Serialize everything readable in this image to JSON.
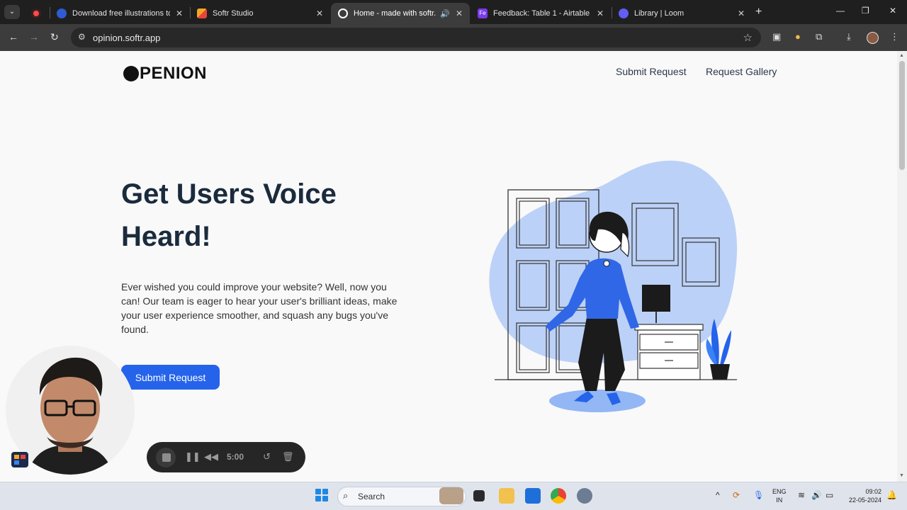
{
  "browser": {
    "tabs": [
      {
        "title": "Download free illustrations to p",
        "close": "✕"
      },
      {
        "title": "Softr Studio",
        "close": "✕"
      },
      {
        "title": "Home - made with softr.io",
        "close": "✕"
      },
      {
        "title": "Feedback: Table 1 - Airtable",
        "close": "✕"
      },
      {
        "title": "Library | Loom",
        "close": "✕"
      }
    ],
    "favicon_label_airtable": "Fe",
    "new_tab": "+",
    "url": "opinion.softr.app",
    "window_controls": {
      "minimize": "—",
      "restore": "❐",
      "close": "✕"
    }
  },
  "site": {
    "logo": "PENION",
    "nav": {
      "submit": "Submit Request",
      "gallery": "Request Gallery"
    },
    "hero": {
      "title": "Get Users Voice Heard!",
      "text": "Ever wished you could improve your website? Well, now you can! Our team is eager to hear your user's brilliant ideas, make your user experience smoother, and squash any bugs you've found.",
      "cta": "Submit Request"
    }
  },
  "recorder": {
    "time": "5:00"
  },
  "taskbar": {
    "search_placeholder": "Search",
    "lang_1": "ENG",
    "lang_2": "IN",
    "time": "09:02",
    "date": "22-05-2024"
  },
  "colors": {
    "accent": "#2563eb",
    "blob": "#bcd1f7",
    "heading": "#1a2b3c"
  }
}
